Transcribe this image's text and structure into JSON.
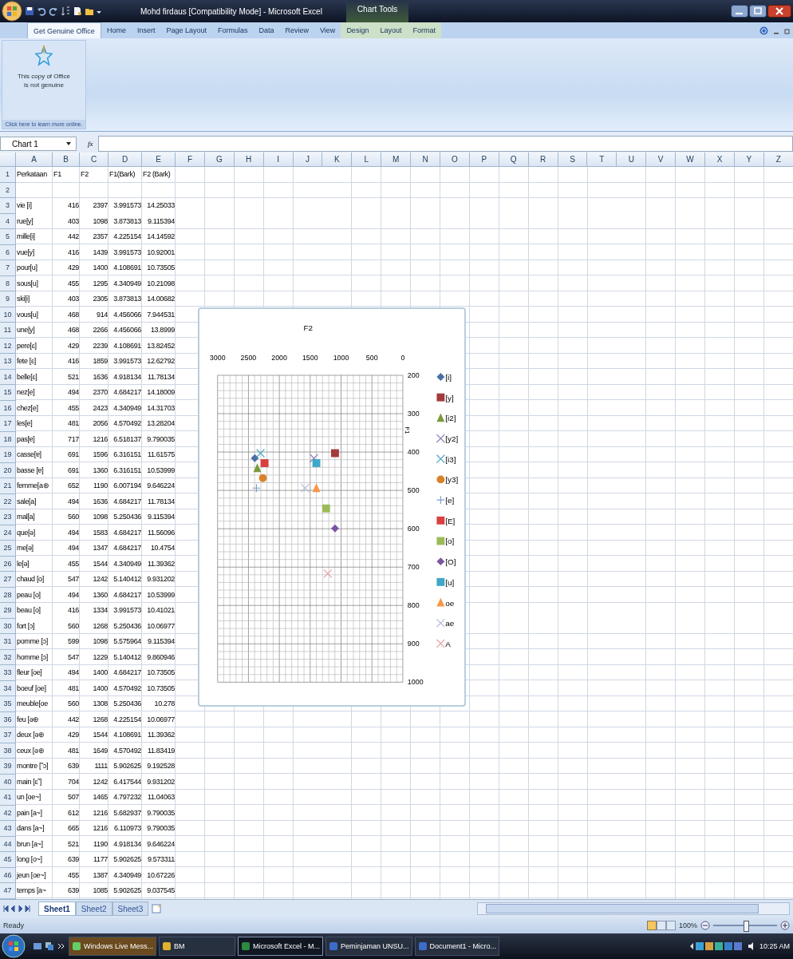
{
  "window": {
    "title": "Mohd firdaus  [Compatibility Mode] - Microsoft Excel",
    "context_label": "Chart Tools"
  },
  "ribbon": {
    "tabs": [
      {
        "label": "Get Genuine Office",
        "selected": true,
        "contextual": false
      },
      {
        "label": "Home",
        "selected": false,
        "contextual": false
      },
      {
        "label": "Insert",
        "selected": false,
        "contextual": false
      },
      {
        "label": "Page Layout",
        "selected": false,
        "contextual": false
      },
      {
        "label": "Formulas",
        "selected": false,
        "contextual": false
      },
      {
        "label": "Data",
        "selected": false,
        "contextual": false
      },
      {
        "label": "Review",
        "selected": false,
        "contextual": false
      },
      {
        "label": "View",
        "selected": false,
        "contextual": false
      },
      {
        "label": "Design",
        "selected": false,
        "contextual": true
      },
      {
        "label": "Layout",
        "selected": false,
        "contextual": true
      },
      {
        "label": "Format",
        "selected": false,
        "contextual": true
      }
    ],
    "genuine_panel": {
      "message": "This copy of Office\nis not genuine",
      "link": "Click here to learn more online."
    }
  },
  "formula_bar": {
    "name_box": "Chart 1",
    "function_label": "fx"
  },
  "sheet": {
    "columns": [
      "A",
      "B",
      "C",
      "D",
      "E",
      "F",
      "G",
      "H",
      "I",
      "J",
      "K",
      "L",
      "M",
      "N",
      "O",
      "P",
      "Q",
      "R",
      "S",
      "T",
      "U",
      "V",
      "W",
      "X",
      "Y",
      "Z"
    ],
    "header_row": {
      "n": "1",
      "cells": [
        "Perkataan",
        "F1",
        "F2",
        "F1(Bark)",
        "F2 (Bark)"
      ]
    },
    "rows": [
      {
        "n": "2"
      },
      {
        "n": "3",
        "cells": [
          "vie [i]",
          "416",
          "2397",
          "3.991573",
          "14.25033"
        ]
      },
      {
        "n": "4",
        "cells": [
          "rue[y]",
          "403",
          "1098",
          "3.873813",
          "9.115394"
        ]
      },
      {
        "n": "5",
        "cells": [
          "mille[i]",
          "442",
          "2357",
          "4.225154",
          "14.14592"
        ]
      },
      {
        "n": "6",
        "cells": [
          "vue[y]",
          "416",
          "1439",
          "3.991573",
          "10.92001"
        ]
      },
      {
        "n": "7",
        "cells": [
          "pour[u]",
          "429",
          "1400",
          "4.108691",
          "10.73505"
        ]
      },
      {
        "n": "8",
        "cells": [
          "sous[u]",
          "455",
          "1295",
          "4.340949",
          "10.21098"
        ]
      },
      {
        "n": "9",
        "cells": [
          "ski[i]",
          "403",
          "2305",
          "3.873813",
          "14.00682"
        ]
      },
      {
        "n": "10",
        "cells": [
          "vous[u]",
          "468",
          "914",
          "4.456066",
          "7.944531"
        ]
      },
      {
        "n": "11",
        "cells": [
          "une[y]",
          "468",
          "2266",
          "4.456066",
          "13.8999"
        ]
      },
      {
        "n": "12",
        "cells": [
          "pere[ɛ]",
          "429",
          "2239",
          "4.108691",
          "13.82452"
        ]
      },
      {
        "n": "13",
        "cells": [
          "fete [ɛ]",
          "416",
          "1859",
          "3.991573",
          "12.62792"
        ]
      },
      {
        "n": "14",
        "cells": [
          "belle[ɛ]",
          "521",
          "1636",
          "4.918134",
          "11.78134"
        ]
      },
      {
        "n": "15",
        "cells": [
          "nez[e]",
          "494",
          "2370",
          "4.684217",
          "14.18009"
        ]
      },
      {
        "n": "16",
        "cells": [
          "chez[e]",
          "455",
          "2423",
          "4.340949",
          "14.31703"
        ]
      },
      {
        "n": "17",
        "cells": [
          "les[e]",
          "481",
          "2056",
          "4.570492",
          "13.28204"
        ]
      },
      {
        "n": "18",
        "cells": [
          "pas[ɐ]",
          "717",
          "1216",
          "6.518137",
          "9.790035"
        ]
      },
      {
        "n": "19",
        "cells": [
          "casse[ɐ]",
          "691",
          "1596",
          "6.316151",
          "11.61575"
        ]
      },
      {
        "n": "20",
        "cells": [
          "basse [ɐ]",
          "691",
          "1360",
          "6.316151",
          "10.53999"
        ]
      },
      {
        "n": "21",
        "cells": [
          "femme[a⊛",
          "652",
          "1190",
          "6.007194",
          "9.646224"
        ]
      },
      {
        "n": "22",
        "cells": [
          "sale[a]",
          "494",
          "1636",
          "4.684217",
          "11.78134"
        ]
      },
      {
        "n": "23",
        "cells": [
          "mal[a]",
          "560",
          "1098",
          "5.250436",
          "9.115394"
        ]
      },
      {
        "n": "24",
        "cells": [
          "que[ə]",
          "494",
          "1583",
          "4.684217",
          "11.56096"
        ]
      },
      {
        "n": "25",
        "cells": [
          "me[ə]",
          "494",
          "1347",
          "4.684217",
          "10.4754"
        ]
      },
      {
        "n": "26",
        "cells": [
          "le[ə]",
          "455",
          "1544",
          "4.340949",
          "11.39362"
        ]
      },
      {
        "n": "27",
        "cells": [
          "chaud [o]",
          "547",
          "1242",
          "5.140412",
          "9.931202"
        ]
      },
      {
        "n": "28",
        "cells": [
          "peau [o]",
          "494",
          "1360",
          "4.684217",
          "10.53999"
        ]
      },
      {
        "n": "29",
        "cells": [
          "beau [o]",
          "416",
          "1334",
          "3.991573",
          "10.41021"
        ]
      },
      {
        "n": "30",
        "cells": [
          "fort [ɔ]",
          "560",
          "1268",
          "5.250436",
          "10.06977"
        ]
      },
      {
        "n": "31",
        "cells": [
          "pomme [ɔ]",
          "599",
          "1098",
          "5.575964",
          "9.115394"
        ]
      },
      {
        "n": "32",
        "cells": [
          "homme [ɔ]",
          "547",
          "1229",
          "5.140412",
          "9.860946"
        ]
      },
      {
        "n": "33",
        "cells": [
          "fleur [oe]",
          "494",
          "1400",
          "4.684217",
          "10.73505"
        ]
      },
      {
        "n": "34",
        "cells": [
          "boeuf [oe]",
          "481",
          "1400",
          "4.570492",
          "10.73505"
        ]
      },
      {
        "n": "35",
        "cells": [
          "meuble[oe",
          "560",
          "1308",
          "5.250436",
          "10.278"
        ]
      },
      {
        "n": "36",
        "cells": [
          "feu [ə⊛",
          "442",
          "1268",
          "4.225154",
          "10.06977"
        ]
      },
      {
        "n": "37",
        "cells": [
          "deux [ə⊛",
          "429",
          "1544",
          "4.108691",
          "11.39362"
        ]
      },
      {
        "n": "38",
        "cells": [
          "ceux [ə⊛",
          "481",
          "1649",
          "4.570492",
          "11.83419"
        ]
      },
      {
        "n": "39",
        "cells": [
          "montre [˜ɔ]",
          "639",
          "1111",
          "5.902625",
          "9.192528"
        ]
      },
      {
        "n": "40",
        "cells": [
          "main [ɛ˜]",
          "704",
          "1242",
          "6.417544",
          "9.931202"
        ]
      },
      {
        "n": "41",
        "cells": [
          "un [oe~]",
          "507",
          "1465",
          "4.797232",
          "11.04063"
        ]
      },
      {
        "n": "42",
        "cells": [
          "pain [a~]",
          "612",
          "1216",
          "5.682937",
          "9.790035"
        ]
      },
      {
        "n": "43",
        "cells": [
          "dans [a~]",
          "665",
          "1216",
          "6.110973",
          "9.790035"
        ]
      },
      {
        "n": "44",
        "cells": [
          "brun [a~]",
          "521",
          "1190",
          "4.918134",
          "9.646224"
        ]
      },
      {
        "n": "45",
        "cells": [
          "long [o~]",
          "639",
          "1177",
          "5.902625",
          "9.573311"
        ]
      },
      {
        "n": "46",
        "cells": [
          "jeun [oe~]",
          "455",
          "1387",
          "4.340949",
          "10.67226"
        ]
      },
      {
        "n": "47",
        "cells": [
          "temps [a~",
          "639",
          "1085",
          "5.902625",
          "9.037545"
        ]
      }
    ],
    "chart": {
      "chart_data": {
        "type": "scatter",
        "title": "F2",
        "ylabel": "F1",
        "xlim": [
          3000,
          0
        ],
        "ylim": [
          1000,
          200
        ],
        "xticks": [
          3000,
          2500,
          2000,
          1500,
          1000,
          500,
          0
        ],
        "yticks": [
          200,
          300,
          400,
          500,
          600,
          700,
          800,
          900,
          1000
        ],
        "grid": true,
        "legend": true,
        "series": [
          {
            "name": "[i]",
            "color": "#4a6fa5",
            "marker": "diamond",
            "x": [
              2397
            ],
            "values": [
              416
            ]
          },
          {
            "name": "[y]",
            "color": "#a33b3b",
            "marker": "square",
            "x": [
              1098
            ],
            "values": [
              403
            ]
          },
          {
            "name": "[i2]",
            "color": "#7a9a3c",
            "marker": "triangle",
            "x": [
              2357
            ],
            "values": [
              442
            ]
          },
          {
            "name": "[y2]",
            "color": "#8a7fb5",
            "marker": "cross",
            "x": [
              1439
            ],
            "values": [
              416
            ]
          },
          {
            "name": "[i3]",
            "color": "#4aa3c0",
            "marker": "cross",
            "x": [
              2305
            ],
            "values": [
              403
            ]
          },
          {
            "name": "[y3]",
            "color": "#d9822b",
            "marker": "circle",
            "x": [
              2266
            ],
            "values": [
              468
            ]
          },
          {
            "name": "[e]",
            "color": "#7f9fd0",
            "marker": "plus",
            "x": [
              2370
            ],
            "values": [
              494
            ]
          },
          {
            "name": "[E]",
            "color": "#d94040",
            "marker": "square",
            "x": [
              2239
            ],
            "values": [
              429
            ]
          },
          {
            "name": "[o]",
            "color": "#9bbb59",
            "marker": "square",
            "x": [
              1242
            ],
            "values": [
              547
            ]
          },
          {
            "name": "[O]",
            "color": "#7b55a0",
            "marker": "diamond",
            "x": [
              1098
            ],
            "values": [
              599
            ]
          },
          {
            "name": "[u]",
            "color": "#3fa7c8",
            "marker": "square",
            "x": [
              1400
            ],
            "values": [
              429
            ]
          },
          {
            "name": "oe",
            "color": "#f79646",
            "marker": "triangle",
            "x": [
              1400
            ],
            "values": [
              494
            ]
          },
          {
            "name": "ae",
            "color": "#b0b8d8",
            "marker": "cross",
            "x": [
              1583
            ],
            "values": [
              494
            ]
          },
          {
            "name": "A",
            "color": "#e6a0a0",
            "marker": "cross",
            "x": [
              1216
            ],
            "values": [
              717
            ]
          }
        ]
      }
    }
  },
  "sheet_tabs": [
    {
      "label": "Sheet1",
      "selected": true
    },
    {
      "label": "Sheet2",
      "selected": false
    },
    {
      "label": "Sheet3",
      "selected": false
    }
  ],
  "status_bar": {
    "text": "Ready",
    "zoom": "100%",
    "zoom_slider": {
      "level": 0.5
    }
  },
  "taskbar": {
    "items": [
      {
        "label": "Windows Live Mess...",
        "selected": false
      },
      {
        "label": "BM",
        "selected": false
      },
      {
        "label": "Microsoft Excel - M...",
        "selected": true
      },
      {
        "label": "Peminjaman UNSU...",
        "selected": false
      },
      {
        "label": "Document1 - Micro...",
        "selected": false
      }
    ],
    "clock": "10:25 AM"
  }
}
